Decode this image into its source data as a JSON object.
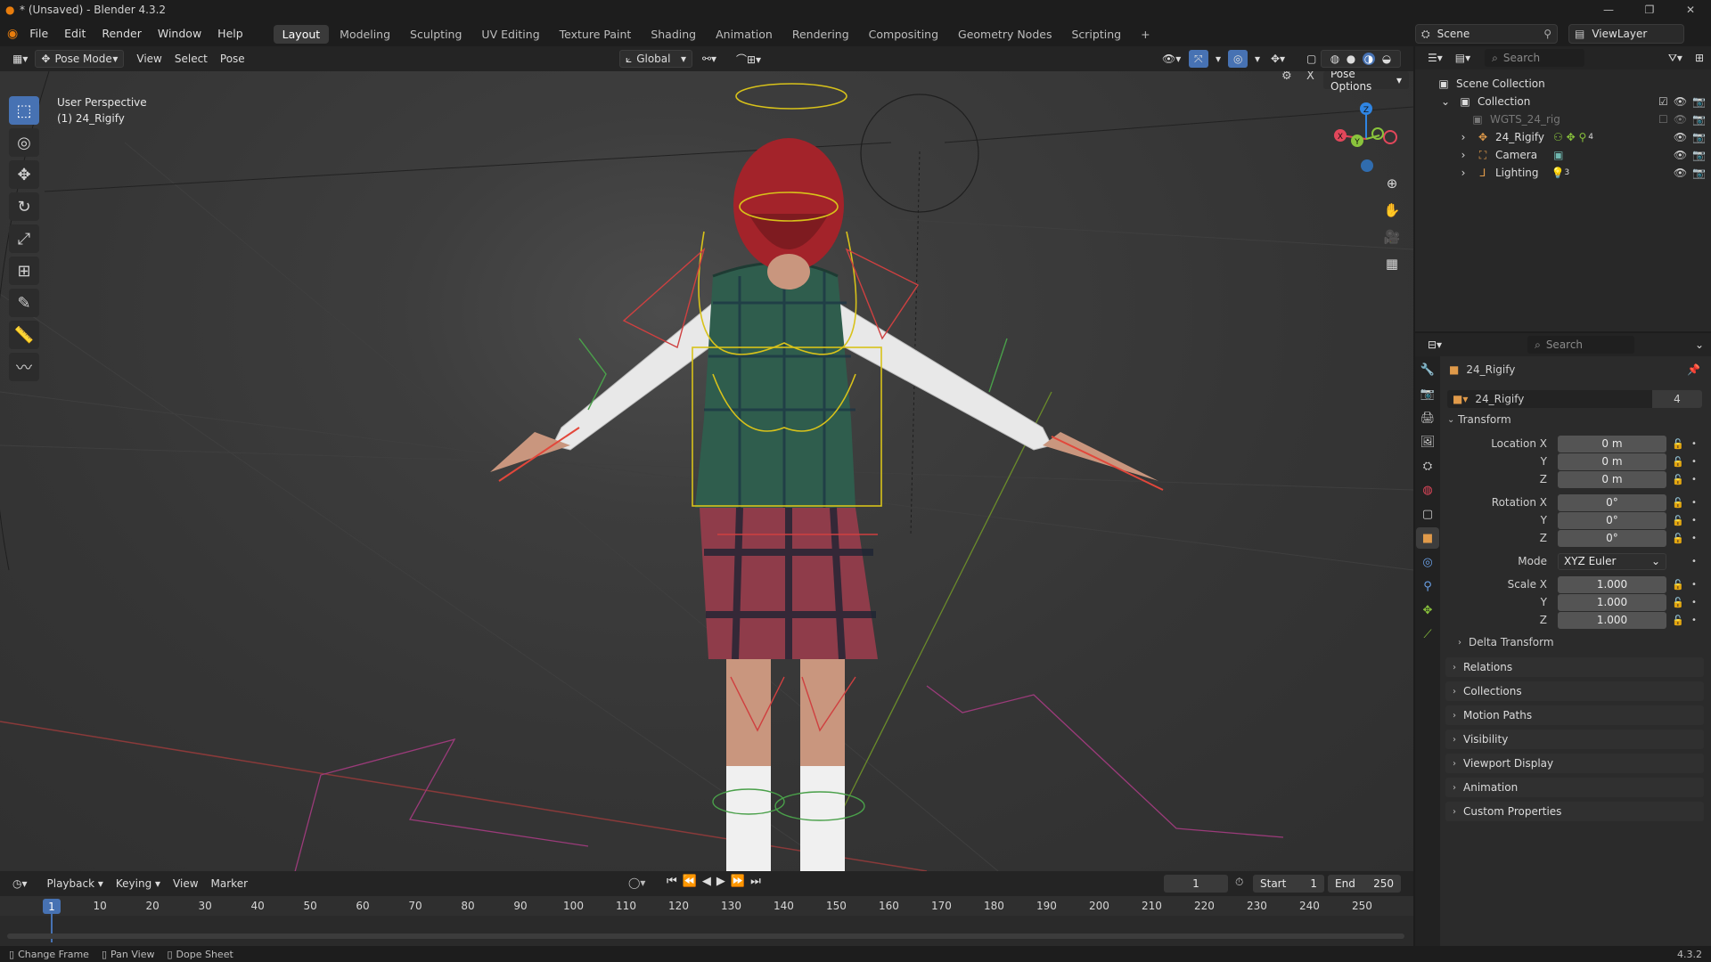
{
  "window": {
    "title": "* (Unsaved) - Blender 4.3.2",
    "controls": [
      "—",
      "❐",
      "✕"
    ]
  },
  "menu": [
    "File",
    "Edit",
    "Render",
    "Window",
    "Help"
  ],
  "workspaces": [
    "Layout",
    "Modeling",
    "Sculpting",
    "UV Editing",
    "Texture Paint",
    "Shading",
    "Animation",
    "Rendering",
    "Compositing",
    "Geometry Nodes",
    "Scripting",
    "+"
  ],
  "active_workspace": "Layout",
  "scene_selector": {
    "label": "Scene"
  },
  "viewlayer_selector": {
    "label": "ViewLayer"
  },
  "viewport_header": {
    "mode": "Pose Mode",
    "menus": [
      "View",
      "Select",
      "Pose"
    ],
    "orientation": "Global",
    "pose_options": "Pose Options"
  },
  "viewport": {
    "view_name": "User Perspective",
    "object_name": "(1) 24_Rigify",
    "gizmo_axes": [
      "X",
      "Y",
      "Z"
    ]
  },
  "outliner": {
    "search_placeholder": "Search",
    "items": [
      {
        "label": "Scene Collection",
        "depth": 0
      },
      {
        "label": "Collection",
        "depth": 1
      },
      {
        "label": "WGTS_24_rig",
        "depth": 2
      },
      {
        "label": "24_Rigify",
        "depth": 2,
        "badge": "4"
      },
      {
        "label": "Camera",
        "depth": 2
      },
      {
        "label": "Lighting",
        "depth": 2,
        "badge": "3"
      }
    ]
  },
  "properties": {
    "search_placeholder": "Search",
    "object_title": "24_Rigify",
    "datablock_name": "24_Rigify",
    "datablock_users": "4",
    "transform_header": "Transform",
    "location": {
      "label": "Location X",
      "x": "0 m",
      "y": "0 m",
      "z": "0 m"
    },
    "rotation": {
      "label": "Rotation X",
      "x": "0°",
      "y": "0°",
      "z": "0°"
    },
    "mode": {
      "label": "Mode",
      "value": "XYZ Euler"
    },
    "scale": {
      "label": "Scale X",
      "x": "1.000",
      "y": "1.000",
      "z": "1.000"
    },
    "axis_labels": {
      "y": "Y",
      "z": "Z"
    },
    "delta_transform": "Delta Transform",
    "panels": [
      "Relations",
      "Collections",
      "Motion Paths",
      "Visibility",
      "Viewport Display",
      "Animation",
      "Custom Properties"
    ]
  },
  "timeline": {
    "menus": [
      "Playback",
      "Keying",
      "View",
      "Marker"
    ],
    "current_frame": "1",
    "start_label": "Start",
    "start": "1",
    "end_label": "End",
    "end": "250",
    "frame_badge": "1",
    "ticks": [
      "10",
      "20",
      "30",
      "40",
      "50",
      "60",
      "70",
      "80",
      "90",
      "100",
      "110",
      "120",
      "130",
      "140",
      "150",
      "160",
      "170",
      "180",
      "190",
      "200",
      "210",
      "220",
      "230",
      "240",
      "250"
    ]
  },
  "statusbar": {
    "hints": [
      "Change Frame",
      "Pan View",
      "Dope Sheet"
    ],
    "version": "4.3.2"
  },
  "colors": {
    "accent_blue": "#4772b3",
    "axis_x": "#e2475b",
    "axis_y": "#8ac43c",
    "axis_z": "#2f85e3",
    "hair": "#b3252a",
    "bone_yellow": "#d8c21a"
  }
}
